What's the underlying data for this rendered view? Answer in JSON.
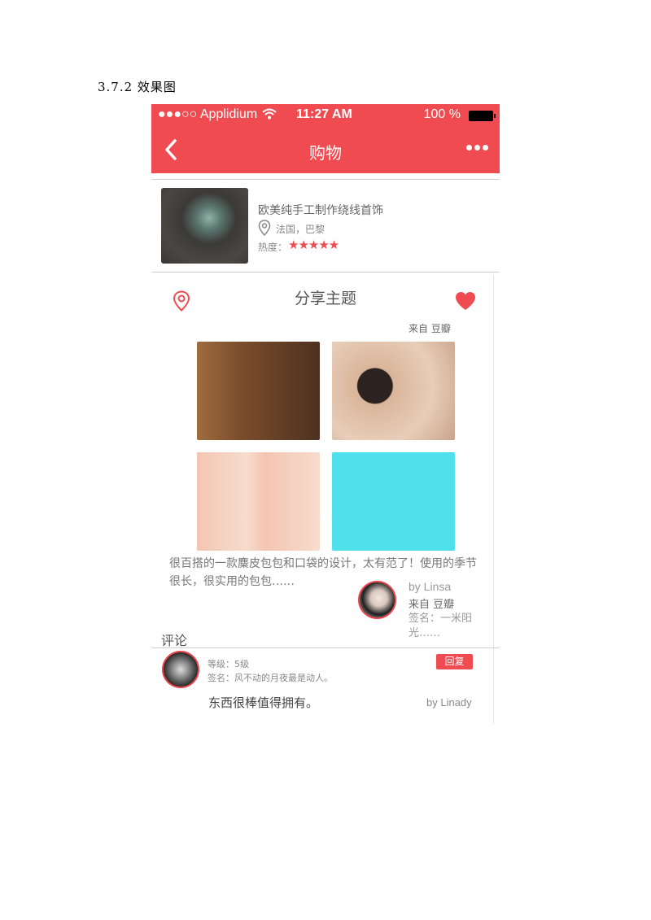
{
  "document": {
    "heading": "3.7.2 效果图"
  },
  "statusbar": {
    "signal": "●●●○○ Applidium",
    "time": "11:27 AM",
    "battery": "100 %"
  },
  "navbar": {
    "title": "购物"
  },
  "product": {
    "title": "欧美纯手工制作绕线首饰",
    "location": "法国，巴黎",
    "heat_label": "热度：",
    "heat_stars": "★★★★★",
    "heat_rating": 5
  },
  "share": {
    "title": "分享主题",
    "from": "来自  豆瓣",
    "description": "很百搭的一款麋皮包包和口袋的设计，太有范了！使用的季节很长，很实用的包包……",
    "author": {
      "by": "by Linsa",
      "from": "来自  豆瓣",
      "signature": "签名：一米阳光……"
    }
  },
  "comments": {
    "heading": "评论",
    "items": [
      {
        "level": "等级：5级",
        "signature": "签名：风不动的月夜最是动人。",
        "reply_label": "回复",
        "text": "东西很棒值得拥有。",
        "by": "by Linady"
      }
    ]
  },
  "colors": {
    "accent": "#f04b50"
  }
}
